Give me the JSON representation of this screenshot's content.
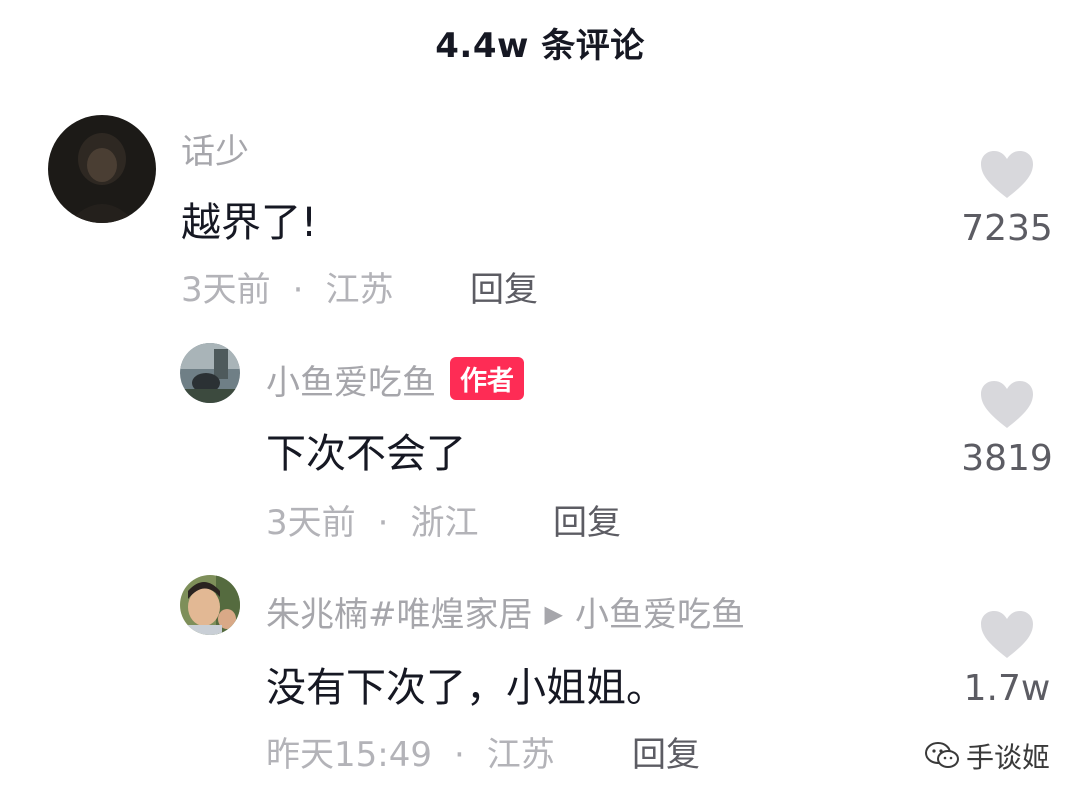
{
  "header": {
    "title": "4.4w 条评论"
  },
  "comments": [
    {
      "username": "话少",
      "text": "越界了!",
      "time": "3天前",
      "separator": "·",
      "location": "江苏",
      "reply_label": "回复",
      "likes": "7235"
    },
    {
      "username": "小鱼爱吃鱼",
      "author_tag": "作者",
      "text": "下次不会了",
      "time": "3天前",
      "separator": "·",
      "location": "浙江",
      "reply_label": "回复",
      "likes": "3819"
    },
    {
      "username": "朱兆楠#唯煌家居",
      "reply_to": "小鱼爱吃鱼",
      "text": "没有下次了，小姐姐。",
      "time": "昨天15:49",
      "separator": "·",
      "location": "江苏",
      "reply_label": "回复",
      "likes": "1.7w"
    }
  ],
  "watermark": {
    "text": "手谈姬"
  },
  "colors": {
    "author_tag": "#fe2c55",
    "like_icon": "#d8d8dc",
    "muted_text": "#a6a6ab"
  },
  "icons": {
    "like": "heart-icon",
    "reply_arrow": "triangle-right-icon",
    "wechat": "wechat-icon"
  }
}
